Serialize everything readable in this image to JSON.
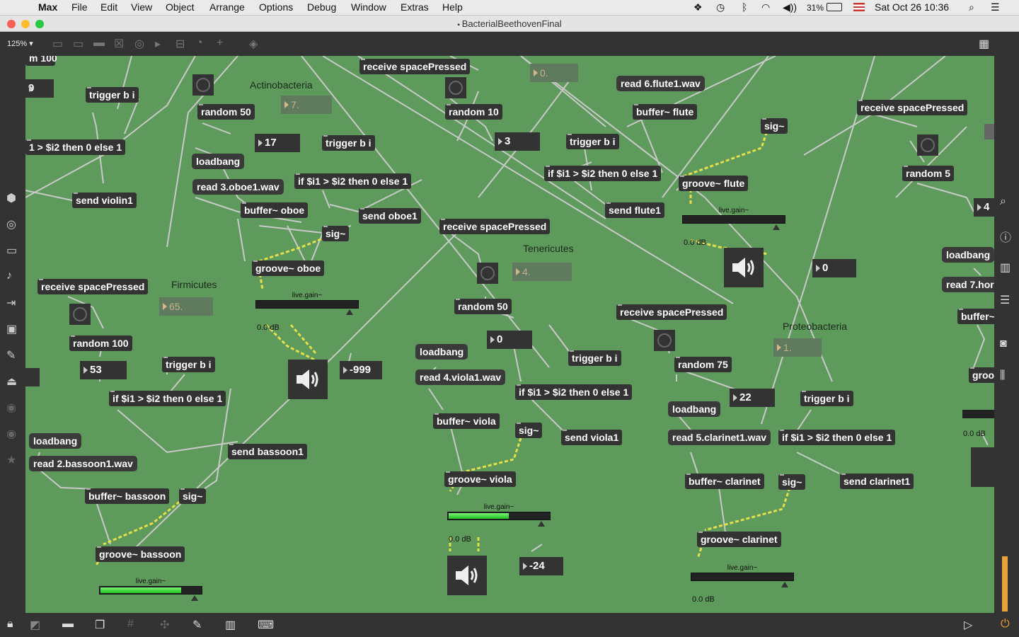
{
  "menubar": {
    "app": "Max",
    "items": [
      "File",
      "Edit",
      "View",
      "Object",
      "Arrange",
      "Options",
      "Debug",
      "Window",
      "Extras",
      "Help"
    ],
    "battery": "31%",
    "datetime": "Sat Oct 26  10:36"
  },
  "window": {
    "title": "BacterialBeethovenFinal"
  },
  "toolbar": {
    "zoom": "125% ▾"
  },
  "patch": {
    "objects": [
      {
        "id": "o1",
        "text": "trigger b i"
      },
      {
        "id": "o2",
        "text": "random 50"
      },
      {
        "id": "o3",
        "text": "1 > $i2 then 0 else 1"
      },
      {
        "id": "o4",
        "text": "trigger b i"
      },
      {
        "id": "o5",
        "text": "if $i1 > $i2 then 0 else 1"
      },
      {
        "id": "o6",
        "text": "send violin1"
      },
      {
        "id": "o7",
        "text": "buffer~ oboe"
      },
      {
        "id": "o8",
        "text": "send oboe1"
      },
      {
        "id": "o9",
        "text": "sig~"
      },
      {
        "id": "o10",
        "text": "groove~ oboe"
      },
      {
        "id": "o11",
        "text": "receive spacePressed"
      },
      {
        "id": "o12",
        "text": "random 10"
      },
      {
        "id": "o13",
        "text": "trigger b i"
      },
      {
        "id": "o14",
        "text": "if $i1 > $i2 then 0 else 1"
      },
      {
        "id": "o15",
        "text": "buffer~ flute"
      },
      {
        "id": "o16",
        "text": "sig~"
      },
      {
        "id": "o17",
        "text": "groove~ flute"
      },
      {
        "id": "o18",
        "text": "send flute1"
      },
      {
        "id": "o19",
        "text": "receive spacePressed"
      },
      {
        "id": "o20",
        "text": "random 5"
      },
      {
        "id": "o21",
        "text": "receive spacePressed"
      },
      {
        "id": "o22",
        "text": "random 50"
      },
      {
        "id": "o23",
        "text": "trigger b i"
      },
      {
        "id": "o24",
        "text": "if $i1 > $i2 then 0 else 1"
      },
      {
        "id": "o25",
        "text": "buffer~ viola"
      },
      {
        "id": "o26",
        "text": "sig~"
      },
      {
        "id": "o27",
        "text": "send viola1"
      },
      {
        "id": "o28",
        "text": "groove~ viola"
      },
      {
        "id": "o29",
        "text": "receive spacePressed"
      },
      {
        "id": "o30",
        "text": "random 100"
      },
      {
        "id": "o31",
        "text": "trigger b i"
      },
      {
        "id": "o32",
        "text": "if $i1 > $i2 then 0 else 1"
      },
      {
        "id": "o33",
        "text": "send bassoon1"
      },
      {
        "id": "o34",
        "text": "buffer~ bassoon"
      },
      {
        "id": "o35",
        "text": "sig~"
      },
      {
        "id": "o36",
        "text": "groove~ bassoon"
      },
      {
        "id": "o37",
        "text": "receive spacePressed"
      },
      {
        "id": "o38",
        "text": "random 75"
      },
      {
        "id": "o39",
        "text": "trigger b i"
      },
      {
        "id": "o40",
        "text": "if $i1 > $i2 then 0 else 1"
      },
      {
        "id": "o41",
        "text": "send clarinet1"
      },
      {
        "id": "o42",
        "text": "buffer~ clarinet"
      },
      {
        "id": "o43",
        "text": "sig~"
      },
      {
        "id": "o44",
        "text": "groove~ clarinet"
      },
      {
        "id": "o45",
        "text": "buffer~"
      },
      {
        "id": "o46",
        "text": "groo"
      }
    ],
    "messages": [
      {
        "id": "m1",
        "text": "loadbang"
      },
      {
        "id": "m2",
        "text": "read 3.oboe1.wav"
      },
      {
        "id": "m3",
        "text": "read 6.flute1.wav"
      },
      {
        "id": "m4",
        "text": "loadbang"
      },
      {
        "id": "m5",
        "text": "read 4.viola1.wav"
      },
      {
        "id": "m6",
        "text": "loadbang"
      },
      {
        "id": "m7",
        "text": "read 2.bassoon1.wav"
      },
      {
        "id": "m8",
        "text": "loadbang"
      },
      {
        "id": "m9",
        "text": "read 5.clarinet1.wav"
      },
      {
        "id": "m10",
        "text": "loadbang"
      },
      {
        "id": "m11",
        "text": "read 7.hor"
      }
    ],
    "numbers": [
      {
        "id": "n1",
        "text": "9"
      },
      {
        "id": "n2",
        "text": "17"
      },
      {
        "id": "n3",
        "text": "3"
      },
      {
        "id": "n4",
        "text": "4"
      },
      {
        "id": "n5",
        "text": "0"
      },
      {
        "id": "n6",
        "text": "0"
      },
      {
        "id": "n7",
        "text": "-999"
      },
      {
        "id": "n8",
        "text": "53"
      },
      {
        "id": "n9",
        "text": "22"
      },
      {
        "id": "n10",
        "text": "-24"
      }
    ],
    "floats": [
      {
        "id": "f1",
        "text": "7."
      },
      {
        "id": "f2",
        "text": "0."
      },
      {
        "id": "f3",
        "text": "4."
      },
      {
        "id": "f4",
        "text": "65."
      },
      {
        "id": "f5",
        "text": "1."
      }
    ],
    "comments": [
      {
        "id": "c1",
        "text": "Actinobacteria"
      },
      {
        "id": "c2",
        "text": "Tenericutes"
      },
      {
        "id": "c3",
        "text": "Firmicutes"
      },
      {
        "id": "c4",
        "text": "Proteobacteria"
      }
    ],
    "gains": [
      {
        "id": "g1",
        "label": "live.gain~",
        "db": "0.0 dB",
        "level": 0
      },
      {
        "id": "g2",
        "label": "live.gain~",
        "db": "0.0 dB",
        "level": 0
      },
      {
        "id": "g3",
        "label": "live.gain~",
        "db": "0.0 dB",
        "level": 0.6
      },
      {
        "id": "g4",
        "label": "live.gain~",
        "db": "0.0 dB",
        "level": 0.8
      },
      {
        "id": "g5",
        "label": "live.gain~",
        "db": "0.0 dB",
        "level": 0
      },
      {
        "id": "g6",
        "label": "",
        "db": "0.0 dB",
        "level": 0
      }
    ],
    "partial_top": "m 100"
  },
  "colors": {
    "canvas": "#5e9a5c",
    "object": "#333333",
    "wire": "#c9c9c9",
    "signal_wire": "#e8e24a"
  }
}
